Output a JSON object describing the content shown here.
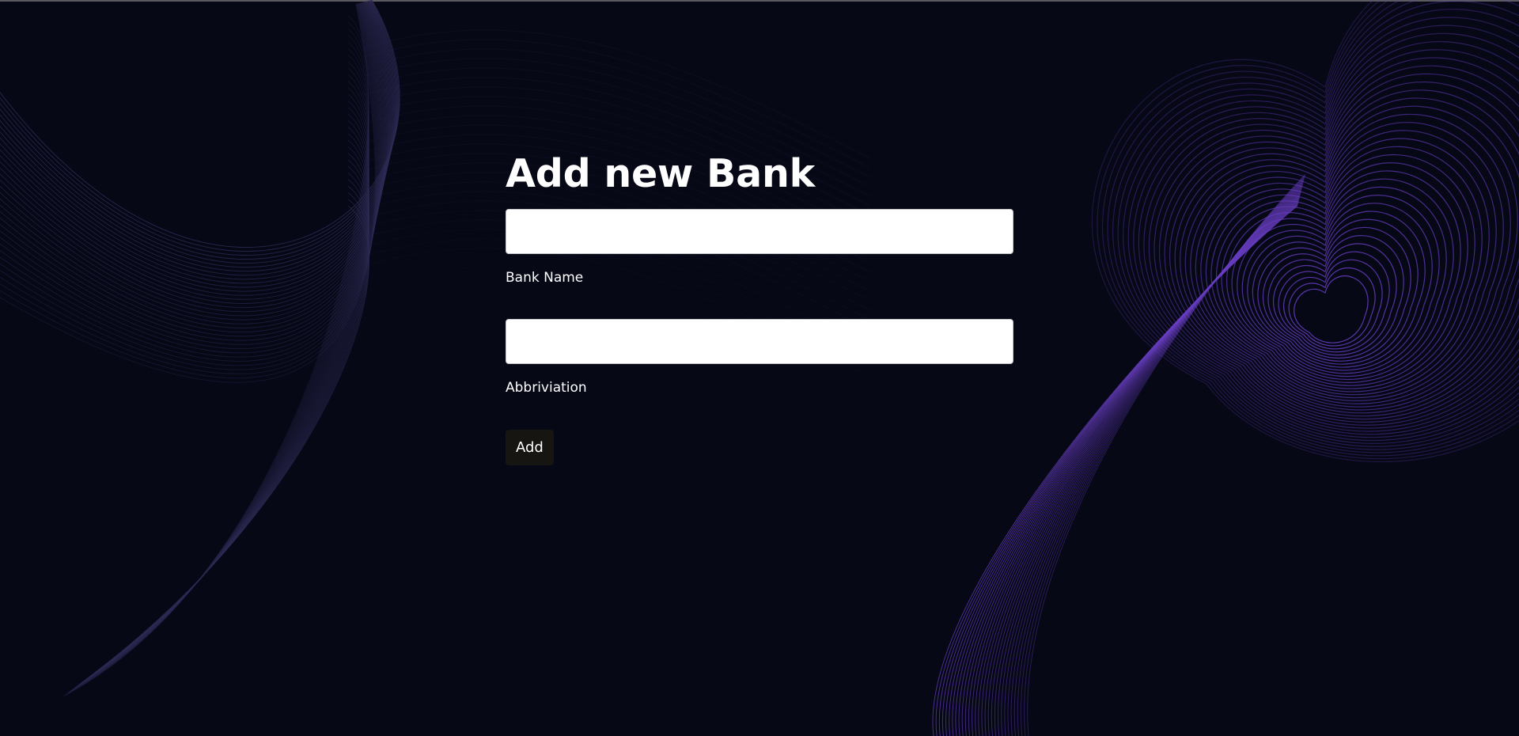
{
  "form": {
    "title": "Add new Bank",
    "bank_name": {
      "label": "Bank Name",
      "value": "",
      "placeholder": ""
    },
    "abbreviation": {
      "label": "Abbriviation",
      "value": "",
      "placeholder": ""
    },
    "add_label": "Add"
  },
  "colors": {
    "background": "#060816",
    "wave_left": "#2f2b55",
    "wave_right": "#6a3fc4",
    "text": "#ffffff",
    "input_background": "#ffffff",
    "button_background": "#161512"
  }
}
